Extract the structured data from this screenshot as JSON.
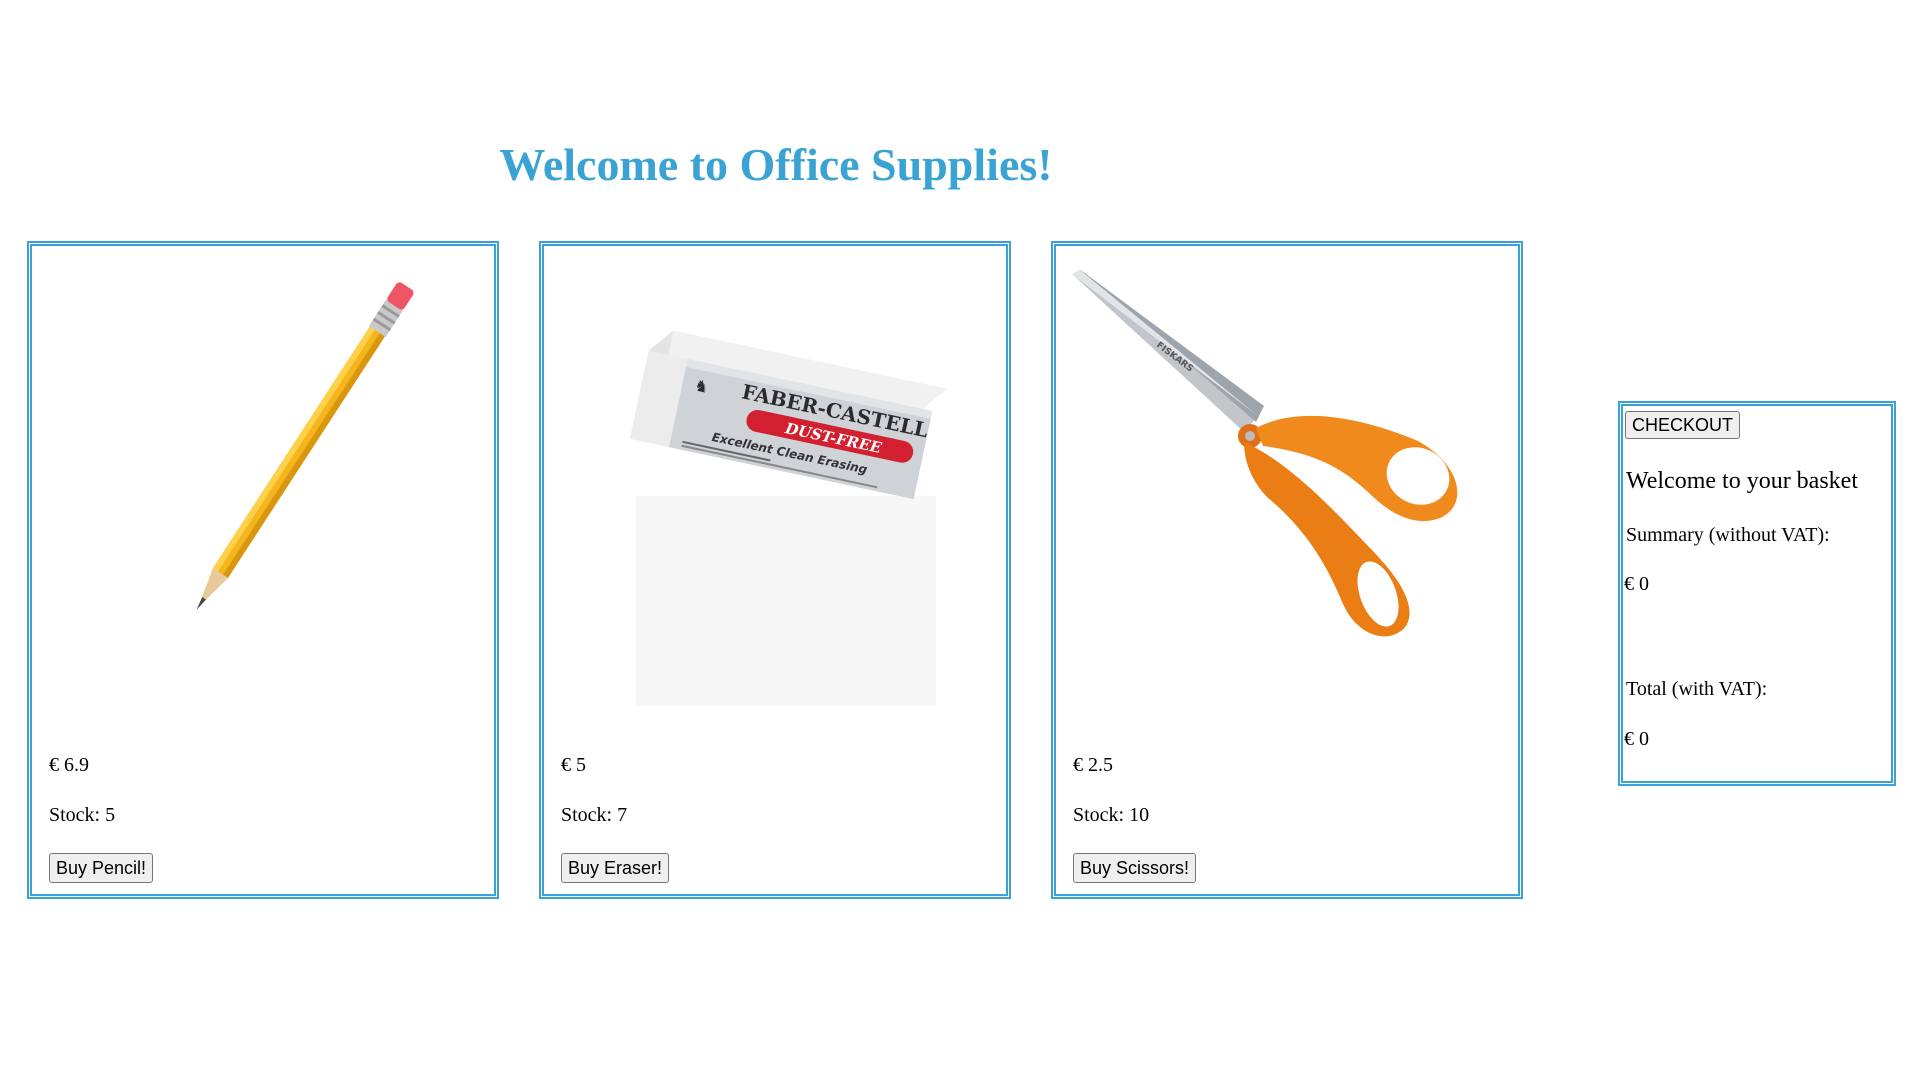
{
  "header": {
    "title": "Welcome to Office Supplies!",
    "accent_color": "#3aa3d3"
  },
  "products": [
    {
      "image_icon": "pencil-image",
      "price": "€ 6.9",
      "stock": "Stock: 5",
      "button_label": "Buy Pencil!"
    },
    {
      "image_icon": "eraser-image",
      "image_text": {
        "brand": "FABER-CASTELL",
        "badge": "DUST-FREE",
        "tagline": "Excellent Clean Erasing"
      },
      "price": "€ 5",
      "stock": "Stock: 7",
      "button_label": "Buy Eraser!"
    },
    {
      "image_icon": "scissors-image",
      "image_text": {
        "brand": "FISKARS"
      },
      "price": "€ 2.5",
      "stock": "Stock: 10",
      "button_label": "Buy Scissors!"
    }
  ],
  "basket": {
    "checkout_label": "CHECKOUT",
    "welcome": "Welcome to your basket",
    "summary_label": "Summary (without VAT):",
    "summary_value": "€ 0",
    "total_label": "Total (with VAT):",
    "total_value": "€ 0"
  }
}
